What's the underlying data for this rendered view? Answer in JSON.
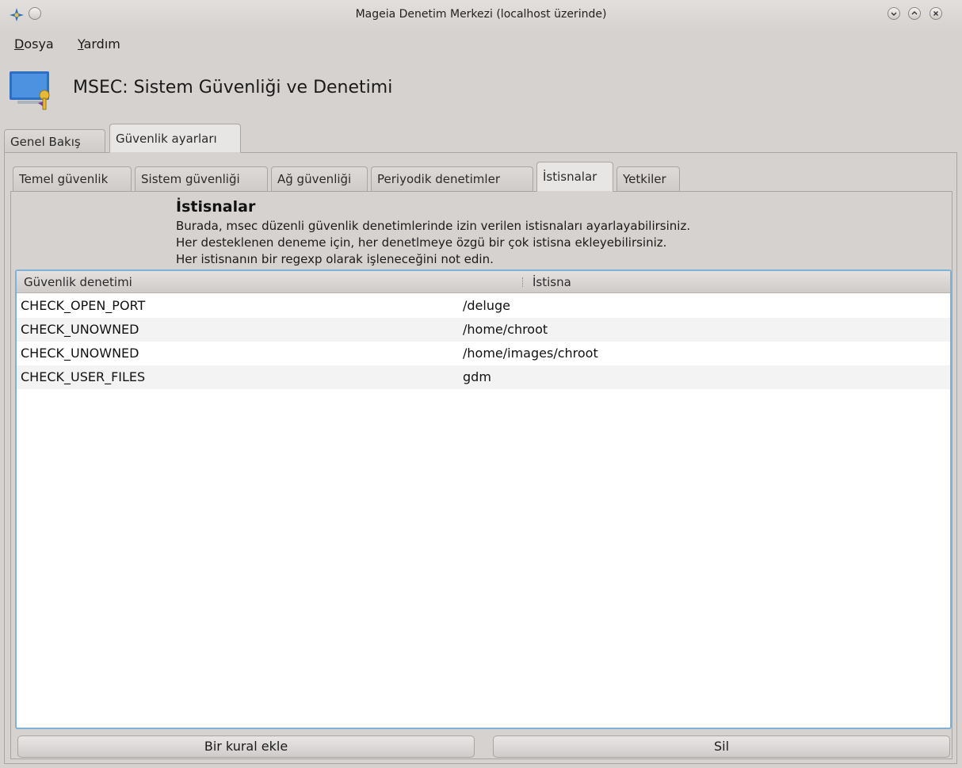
{
  "window": {
    "title": "Mageia Denetim Merkezi  (localhost üzerinde)"
  },
  "menu": {
    "file": {
      "accel": "D",
      "rest": "osya"
    },
    "help": {
      "accel": "Y",
      "rest": "ardım"
    }
  },
  "header": {
    "title": "MSEC: Sistem Güvenliği ve Denetimi"
  },
  "outer_tabs": [
    {
      "label": "Genel Bakış",
      "active": false
    },
    {
      "label": "Güvenlik ayarları",
      "active": true
    }
  ],
  "inner_tabs": [
    {
      "label": "Temel güvenlik",
      "active": false
    },
    {
      "label": "Sistem güvenliği",
      "active": false
    },
    {
      "label": "Ağ güvenliği",
      "active": false
    },
    {
      "label": "Periyodik denetimler",
      "active": false
    },
    {
      "label": "İstisnalar",
      "active": true
    },
    {
      "label": "Yetkiler",
      "active": false
    }
  ],
  "section": {
    "title": "İstisnalar",
    "lines": [
      "Burada, msec düzenli güvenlik denetimlerinde izin verilen istisnaları ayarlayabilirsiniz.",
      "Her desteklenen deneme için, her denetlmeye özgü bir çok istisna ekleyebilirsiniz.",
      "Her istisnanın bir regexp olarak işleneceğini not edin."
    ]
  },
  "table": {
    "columns": [
      "Güvenlik denetimi",
      "İstisna"
    ],
    "rows": [
      [
        "CHECK_OPEN_PORT",
        "/deluge"
      ],
      [
        "CHECK_UNOWNED",
        "/home/chroot"
      ],
      [
        "CHECK_UNOWNED",
        "/home/images/chroot"
      ],
      [
        "CHECK_USER_FILES",
        "gdm"
      ]
    ]
  },
  "buttons": {
    "add": "Bir kural ekle",
    "delete": "Sil"
  },
  "icons": {
    "app": "mageia-app-icon",
    "menu_circle": "window-menu-icon",
    "minimize": "minimize-icon",
    "maximize": "maximize-icon",
    "close": "close-icon",
    "logo": "security-monitor-icon"
  },
  "colors": {
    "table_focus_border": "#7fb2d9",
    "window_bg": "#d6d2d0"
  }
}
